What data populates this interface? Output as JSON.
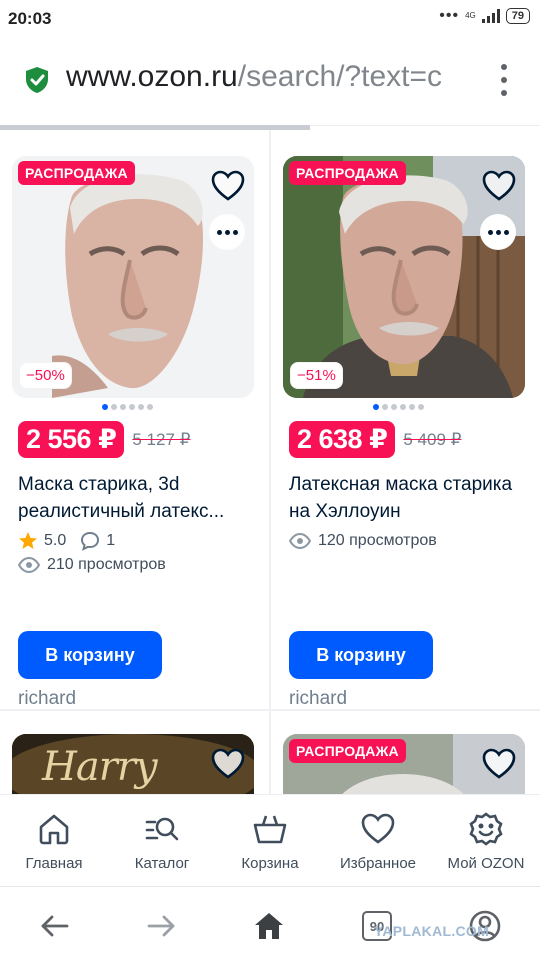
{
  "status_bar": {
    "time": "20:03",
    "network": "4G",
    "battery": "79"
  },
  "browser": {
    "url_host": "www.ozon.ru",
    "url_path": "/search/?text=c"
  },
  "products": [
    {
      "sale_badge": "РАСПРОДАЖА",
      "discount": "−50%",
      "price": "2 556 ₽",
      "old_price": "5 127 ₽",
      "title": "Маска старика, 3d реалистичный латекс...",
      "rating": "5.0",
      "reviews": "1",
      "views": "210 просмотров",
      "cart_button": "В корзину",
      "seller": "richard"
    },
    {
      "sale_badge": "РАСПРОДАЖА",
      "discount": "−51%",
      "price": "2 638 ₽",
      "old_price": "5 409 ₽",
      "title": "Латексная маска старика на Хэллоуин",
      "views": "120 просмотров",
      "cart_button": "В корзину",
      "seller": "richard"
    },
    {
      "image_text": "Harry Potter"
    },
    {
      "sale_badge": "РАСПРОДАЖА"
    }
  ],
  "bottom_nav": [
    {
      "label": "Главная",
      "icon": "home-icon"
    },
    {
      "label": "Каталог",
      "icon": "catalog-search-icon"
    },
    {
      "label": "Корзина",
      "icon": "basket-icon"
    },
    {
      "label": "Избранное",
      "icon": "heart-icon"
    },
    {
      "label": "Мой OZON",
      "icon": "smile-icon"
    }
  ],
  "system_nav": {
    "tab_count": "90",
    "watermark": "YAPLAKAL.COM"
  },
  "colors": {
    "accent": "#005bff",
    "sale": "#f91155",
    "text": "#001a34",
    "muted": "#707f8d"
  }
}
